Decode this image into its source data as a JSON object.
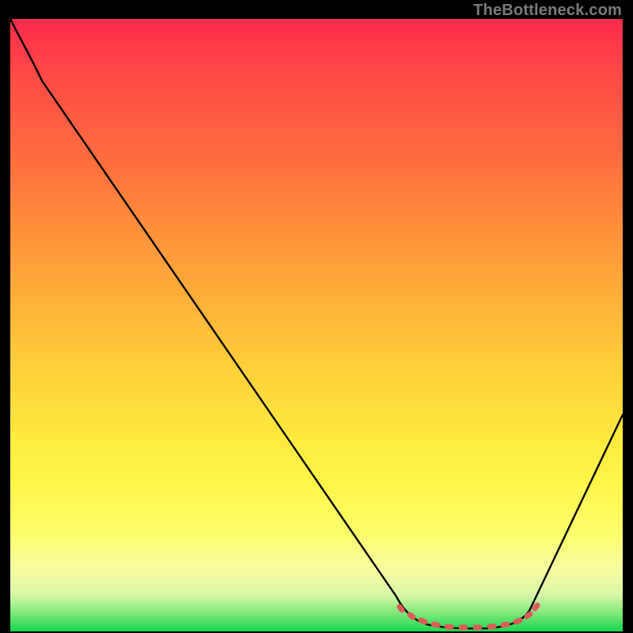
{
  "watermark": "TheBottleneck.com",
  "chart_data": {
    "type": "line",
    "title": "",
    "xlabel": "",
    "ylabel": "",
    "xlim": [
      0,
      100
    ],
    "ylim": [
      0,
      100
    ],
    "grid": false,
    "series": [
      {
        "name": "black-curve",
        "x": [
          0,
          4,
          10,
          20,
          30,
          40,
          50,
          60,
          63,
          65,
          68,
          72,
          76,
          80,
          84,
          100
        ],
        "y": [
          100,
          95,
          89,
          77,
          65,
          53,
          41,
          20,
          8,
          3,
          1,
          0.5,
          0.5,
          1,
          3,
          35
        ]
      },
      {
        "name": "red-dot-band",
        "x": [
          63,
          65,
          67,
          69,
          71,
          73,
          75,
          77,
          79,
          81,
          83,
          85
        ],
        "y": [
          3.2,
          2.0,
          1.4,
          1.0,
          0.9,
          0.8,
          0.8,
          0.9,
          1.1,
          1.5,
          2.2,
          3.4
        ]
      }
    ],
    "background_gradient": {
      "top": "#ff2a4b",
      "middle": "#ffd23a",
      "bottom": "#17d84f"
    }
  }
}
